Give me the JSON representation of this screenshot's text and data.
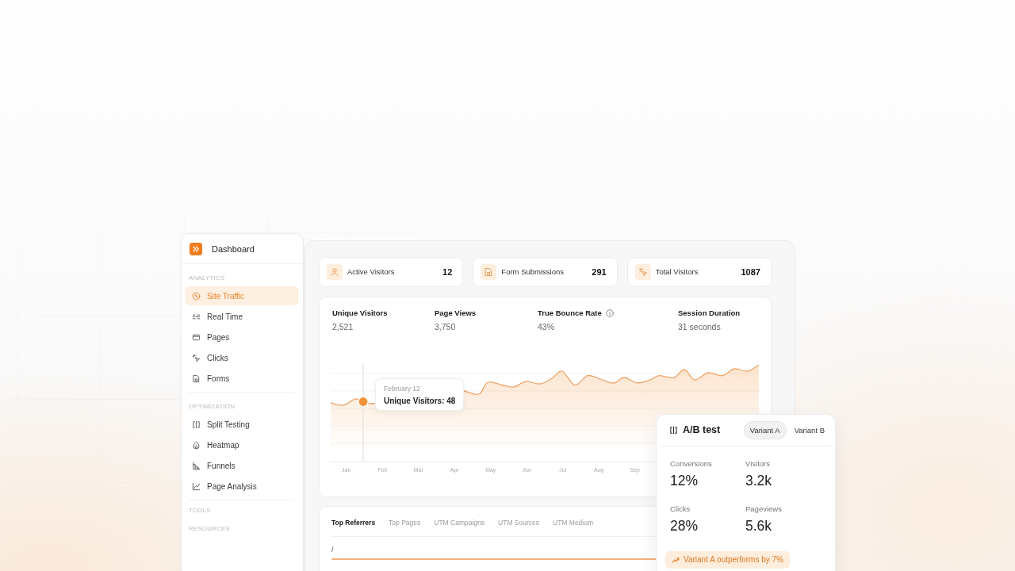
{
  "sidebar": {
    "title": "Dashboard",
    "sections": [
      {
        "heading": "ANALYTICS",
        "items": [
          {
            "label": "Site Traffic",
            "selected": true
          },
          {
            "label": "Real Time",
            "selected": false
          },
          {
            "label": "Pages",
            "selected": false
          },
          {
            "label": "Clicks",
            "selected": false
          },
          {
            "label": "Forms",
            "selected": false
          }
        ]
      },
      {
        "heading": "OPTIMIZATION",
        "items": [
          {
            "label": "Split Testing",
            "selected": false
          },
          {
            "label": "Heatmap",
            "selected": false
          },
          {
            "label": "Funnels",
            "selected": false
          },
          {
            "label": "Page Analysis",
            "selected": false
          }
        ]
      },
      {
        "heading": "TOOLS"
      },
      {
        "heading": "RESOURCES"
      }
    ]
  },
  "stat_cards": [
    {
      "label": "Active Visitors",
      "value": "12"
    },
    {
      "label": "Form Submissions",
      "value": "291"
    },
    {
      "label": "Total Visitors",
      "value": "1087"
    }
  ],
  "metrics": [
    {
      "label": "Unique Visitors",
      "value": "2,521"
    },
    {
      "label": "Page Views",
      "value": "3,750"
    },
    {
      "label": "True Bounce Rate",
      "value": "43%",
      "info": true
    },
    {
      "label": "Session Duration",
      "value": "31 seconds"
    }
  ],
  "chart": {
    "months": [
      "Jan",
      "Feb",
      "Mar",
      "Apr",
      "May",
      "Jun",
      "Jul",
      "Aug",
      "Sep"
    ],
    "tooltip": {
      "date": "February 12",
      "text": "Unique Visitors: 48"
    }
  },
  "report_tabs": [
    {
      "label": "Top Referrers",
      "selected": true
    },
    {
      "label": "Top Pages",
      "selected": false
    },
    {
      "label": "UTM Campaigns",
      "selected": false
    },
    {
      "label": "UTM Sources",
      "selected": false
    },
    {
      "label": "UTM Medium",
      "selected": false
    }
  ],
  "report_rows": [
    {
      "label": "/"
    }
  ],
  "ab_test": {
    "title": "A/B test",
    "variants": [
      {
        "label": "Variant A",
        "selected": true
      },
      {
        "label": "Variant B",
        "selected": false
      }
    ],
    "metrics": [
      {
        "label": "Conversions",
        "value": "12%"
      },
      {
        "label": "Visitors",
        "value": "3.2k"
      },
      {
        "label": "Clicks",
        "value": "28%"
      },
      {
        "label": "Pageviews",
        "value": "5.6k"
      }
    ],
    "note": "Variant A outperforms by 7%"
  }
}
